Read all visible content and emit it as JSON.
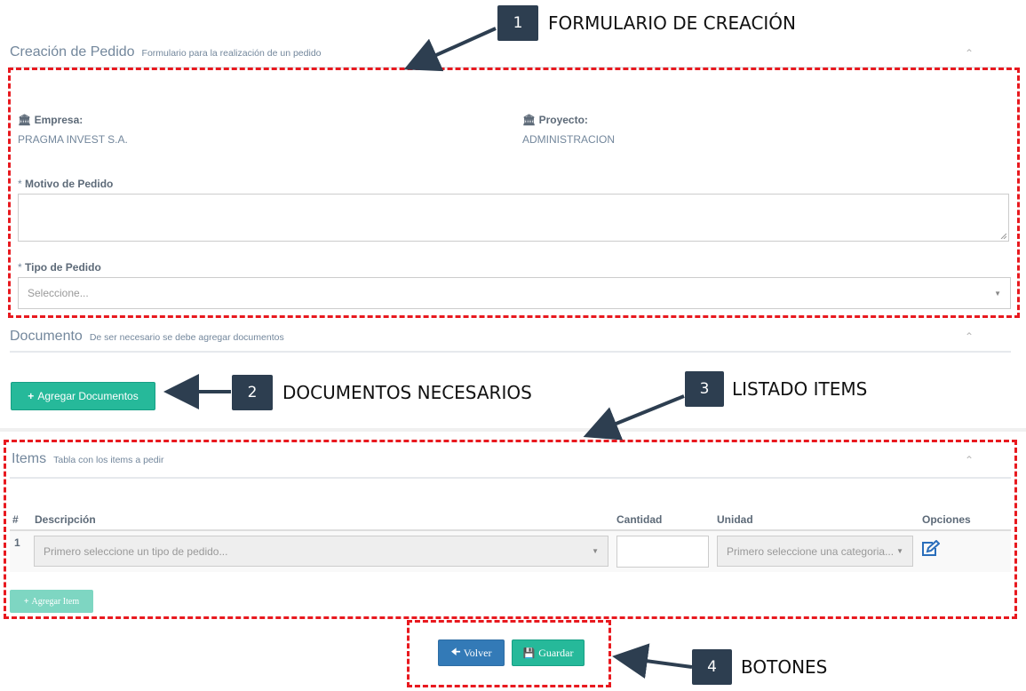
{
  "creation_panel": {
    "title": "Creación de Pedido",
    "subtitle": "Formulario para la realización de un pedido",
    "empresa_label": "Empresa:",
    "empresa_value": "PRAGMA INVEST S.A.",
    "proyecto_label": "Proyecto:",
    "proyecto_value": "ADMINISTRACION",
    "motivo_required": "*",
    "motivo_label": "Motivo de Pedido",
    "tipo_required": "*",
    "tipo_label": "Tipo de Pedido",
    "tipo_placeholder": "Seleccione..."
  },
  "document_panel": {
    "title": "Documento",
    "subtitle": "De ser necesario se debe agregar documentos",
    "add_button": "Agregar Documentos"
  },
  "items_panel": {
    "title": "Items",
    "subtitle": "Tabla con los items a pedir",
    "columns": [
      "#",
      "Descripción",
      "Cantidad",
      "Unidad",
      "Opciones"
    ],
    "rows": [
      {
        "index": "1",
        "description_placeholder": "Primero seleccione un tipo de pedido...",
        "quantity": "",
        "unit_placeholder": "Primero seleccione una categoria..."
      }
    ],
    "add_item_button": "Agregar Item"
  },
  "actions": {
    "back_button": "Volver",
    "save_button": "Guardar"
  },
  "annotations": [
    {
      "number": "1",
      "text": "FORMULARIO DE CREACIÓN"
    },
    {
      "number": "2",
      "text": "DOCUMENTOS NECESARIOS"
    },
    {
      "number": "3",
      "text": "LISTADO ITEMS"
    },
    {
      "number": "4",
      "text": "BOTONES"
    }
  ],
  "colors": {
    "accent_green": "#26b99a",
    "primary_blue": "#337ab7",
    "annotation_red": "#e8191f",
    "badge_dark": "#2d3e50"
  },
  "icons": {
    "institution": "bank-icon",
    "plus": "plus-icon",
    "edit": "edit-icon",
    "back": "arrow-left-icon",
    "save": "floppy-disk-icon",
    "collapse": "chevron-up-icon",
    "dropdown": "caret-down-icon"
  }
}
